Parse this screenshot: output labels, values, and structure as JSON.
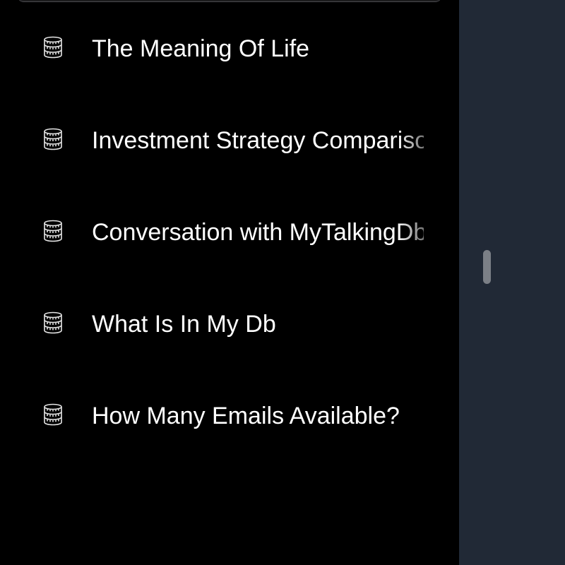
{
  "conversations": [
    {
      "title": "The Meaning Of Life",
      "icon": "database-icon"
    },
    {
      "title": "Investment Strategy Comparison",
      "icon": "database-icon"
    },
    {
      "title": "Conversation with MyTalkingDb",
      "icon": "database-icon"
    },
    {
      "title": "What Is In My Db",
      "icon": "database-icon"
    },
    {
      "title": "How Many Emails Available?",
      "icon": "database-icon"
    }
  ],
  "colors": {
    "sidebar_bg": "#000000",
    "panel_bg": "#212936",
    "text": "#ffffff",
    "scroll_thumb": "#7b7f86"
  }
}
